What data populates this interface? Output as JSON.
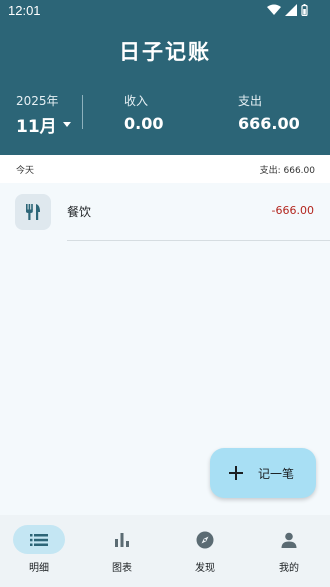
{
  "status_bar": {
    "time": "12:01"
  },
  "app": {
    "title": "日子记账"
  },
  "summary": {
    "year": "2025年",
    "month": "11月",
    "income_label": "收入",
    "income_value": "0.00",
    "expense_label": "支出",
    "expense_value": "666.00"
  },
  "day_group": {
    "label": "今天",
    "total": "支出: 666.00",
    "transactions": [
      {
        "category": "餐饮",
        "amount": "-666.00",
        "icon": "fork-knife-icon"
      }
    ]
  },
  "fab": {
    "label": "记一笔",
    "icon": "plus-icon"
  },
  "nav": [
    {
      "label": "明细",
      "icon": "list-icon",
      "active": true
    },
    {
      "label": "图表",
      "icon": "bar-chart-icon",
      "active": false
    },
    {
      "label": "发现",
      "icon": "compass-icon",
      "active": false
    },
    {
      "label": "我的",
      "icon": "person-icon",
      "active": false
    }
  ],
  "colors": {
    "header": "#2c6577",
    "negative_amount": "#b3261e",
    "fab": "#a8dff4",
    "nav_active": "#c4e6f3"
  }
}
